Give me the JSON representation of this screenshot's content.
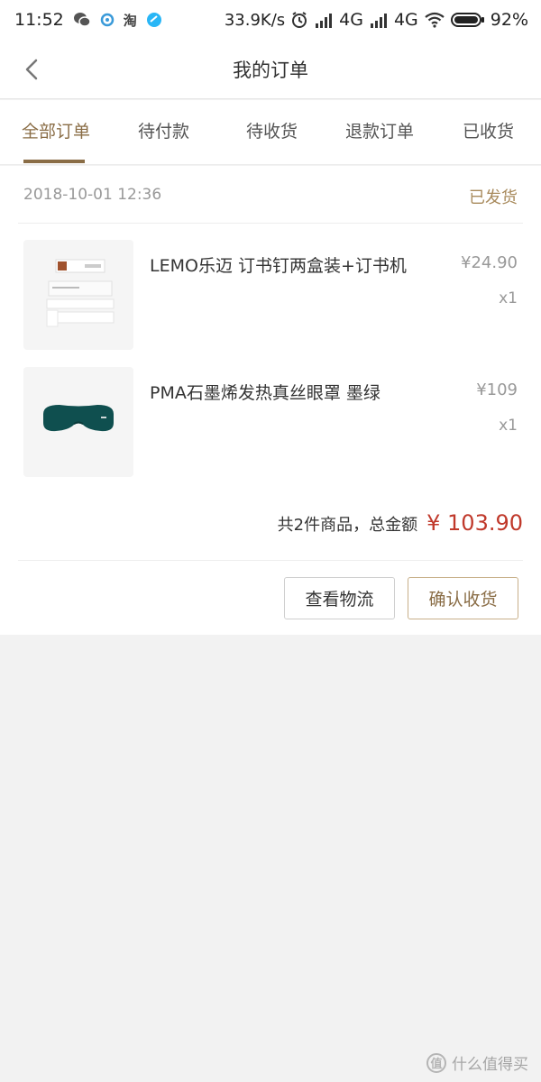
{
  "status_bar": {
    "time": "11:52",
    "net_speed": "33.9K/s",
    "network_1": "4G",
    "network_2": "4G",
    "battery": "92%",
    "app_icon_taobao": "淘"
  },
  "header": {
    "title": "我的订单",
    "back_icon": "chevron-left-icon"
  },
  "tabs": [
    {
      "label": "全部订单",
      "active": true
    },
    {
      "label": "待付款",
      "active": false
    },
    {
      "label": "待收货",
      "active": false
    },
    {
      "label": "退款订单",
      "active": false
    },
    {
      "label": "已收货",
      "active": false
    }
  ],
  "order": {
    "date": "2018-10-01 12:36",
    "status": "已发货",
    "items": [
      {
        "name": "LEMO乐迈 订书钉两盒装+订书机",
        "price": "¥24.90",
        "qty": "x1",
        "image": "stapler-product-image"
      },
      {
        "name": "PMA石墨烯发热真丝眼罩 墨绿",
        "price": "¥109",
        "qty": "x1",
        "image": "eye-mask-product-image"
      }
    ],
    "summary_text": "共2件商品，总金额",
    "total": "¥ 103.90",
    "buttons": {
      "logistics": "查看物流",
      "confirm": "确认收货"
    }
  },
  "watermark": {
    "badge": "值",
    "text": "什么值得买"
  },
  "colors": {
    "accent": "#8a6d46",
    "status": "#a88a5c",
    "price_total": "#c0392b",
    "background": "#f2f2f2"
  }
}
